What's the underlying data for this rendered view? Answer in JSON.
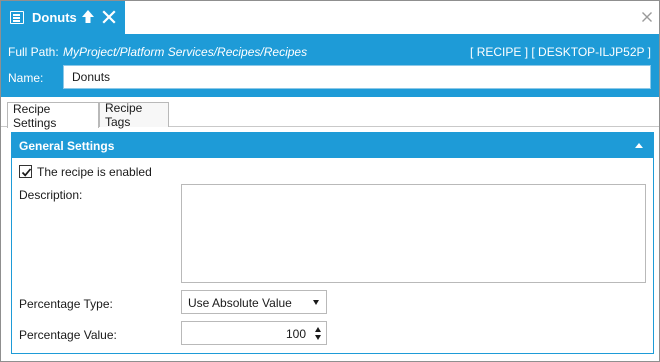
{
  "tab": {
    "title": "Donuts",
    "icon": "recipe-document-icon",
    "pin_icon": "pin-up-arrow-icon",
    "close_icon": "close-x-icon"
  },
  "window": {
    "close_icon": "close-x-icon"
  },
  "header": {
    "fullpath_label": "Full Path:",
    "fullpath_value": "MyProject/Platform Services/Recipes/Recipes",
    "tag": "[ RECIPE ] [ DESKTOP-ILJP52P ]",
    "name_label": "Name:",
    "name_value": "Donuts"
  },
  "settings_tabs": [
    {
      "label": "Recipe Settings",
      "active": true
    },
    {
      "label": "Recipe Tags",
      "active": false
    }
  ],
  "section": {
    "title": "General Settings",
    "collapse_icon": "chevron-up-icon",
    "enabled_checked": true,
    "enabled_label": "The recipe is enabled",
    "description_label": "Description:",
    "description_value": "",
    "percentage_type_label": "Percentage Type:",
    "percentage_type_value": "Use Absolute Value",
    "percentage_value_label": "Percentage Value:",
    "percentage_value": "100"
  },
  "colors": {
    "accent": "#1e9bd7",
    "border": "#8f8f8f"
  }
}
